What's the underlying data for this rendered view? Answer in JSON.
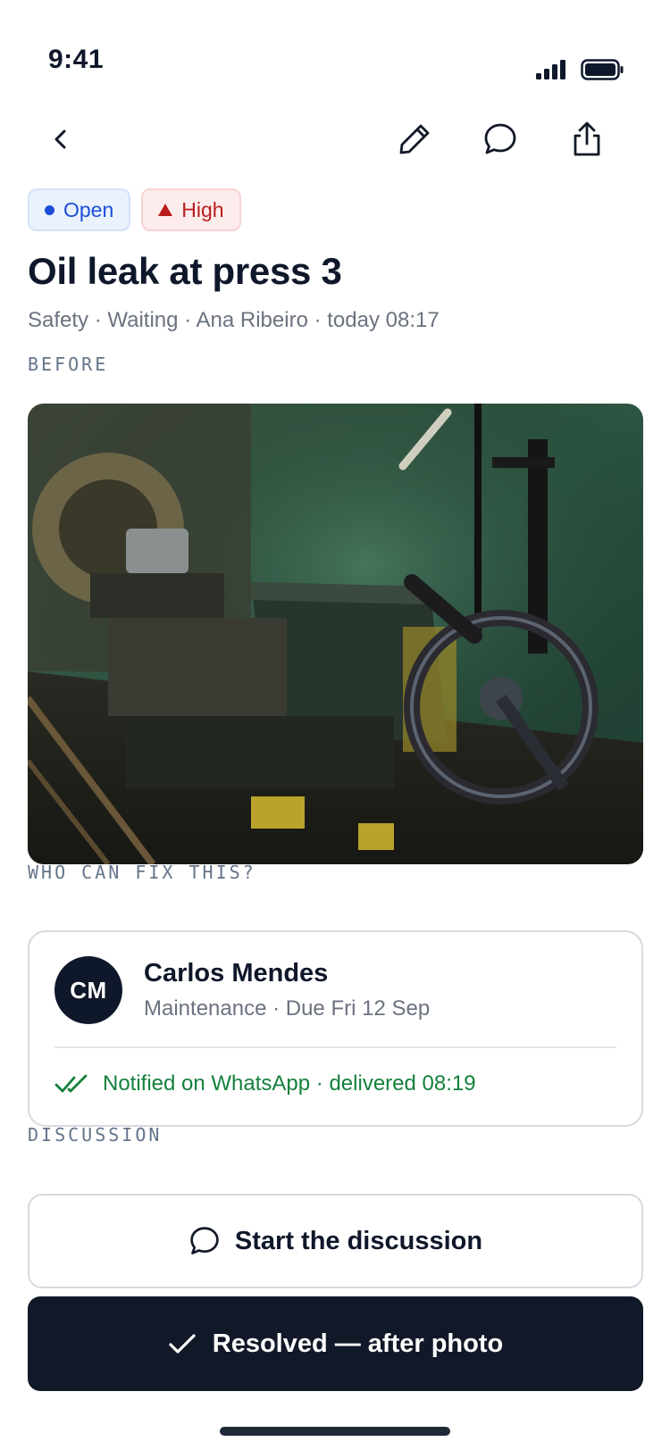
{
  "status_bar": {
    "time": "9:41"
  },
  "nav": {
    "back_icon": "chevron-left-icon",
    "edit_icon": "pencil-icon",
    "comment_icon": "chat-bubble-icon",
    "share_icon": "share-icon"
  },
  "badges": {
    "status": "Open",
    "priority": "High"
  },
  "issue": {
    "title": "Oil leak at press 3",
    "meta": "Safety · Waiting · Ana Ribeiro · today 08:17"
  },
  "before": {
    "label": "BEFORE"
  },
  "assignee": {
    "section_label": "WHO CAN FIX THIS?",
    "initials": "CM",
    "name": "Carlos Mendes",
    "meta": "Maintenance · Due Fri 12 Sep",
    "notification": "Notified on WhatsApp · delivered 08:19"
  },
  "discussion": {
    "section_label": "DISCUSSION",
    "button_label": "Start the discussion"
  },
  "actions": {
    "resolve_label": "Resolved — after photo"
  },
  "colors": {
    "primary_dark": "#111827",
    "open_blue": "#1d4ed8",
    "high_red": "#b91c1c",
    "success_green": "#15803d",
    "muted_text": "#6b7280"
  }
}
